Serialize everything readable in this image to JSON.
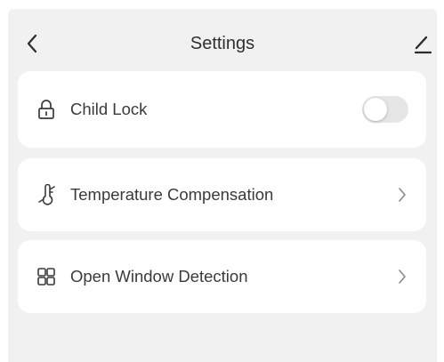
{
  "header": {
    "title": "Settings",
    "back_icon": "chevron-left-icon",
    "edit_icon": "edit-pencil-icon"
  },
  "settings": [
    {
      "label": "Child Lock",
      "icon": "lock-icon",
      "control": "toggle",
      "enabled": false
    },
    {
      "label": "Temperature Compensation",
      "icon": "thermometer-icon",
      "control": "chevron"
    },
    {
      "label": "Open Window Detection",
      "icon": "window-icon",
      "control": "chevron"
    }
  ],
  "colors": {
    "background": "#f1f1f1",
    "card": "#ffffff",
    "text": "#333333",
    "toggle_off": "#e6e6e6"
  }
}
